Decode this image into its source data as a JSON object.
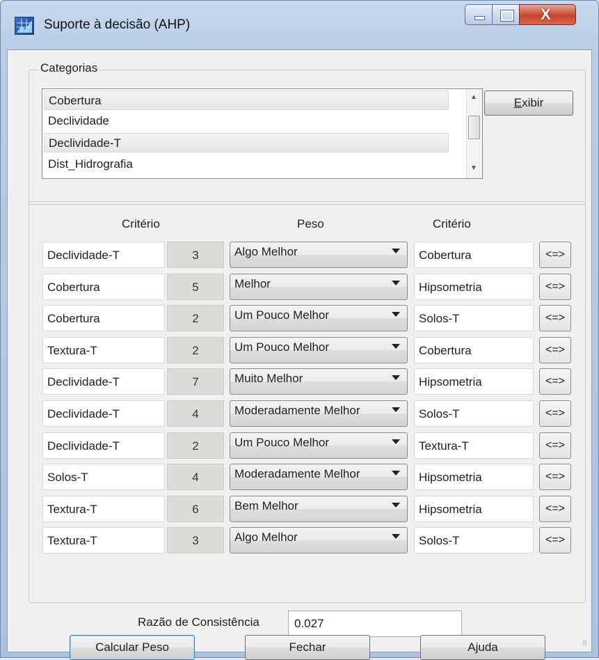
{
  "window": {
    "title": "Suporte à decisão (AHP)"
  },
  "categorias": {
    "label": "Categorias",
    "items": [
      "Cobertura",
      "Declividade",
      "Declividade-T",
      "Dist_Hidrografia"
    ],
    "exibir_label": "Exibir"
  },
  "table": {
    "header_criterio_left": "Critério",
    "header_peso": "Peso",
    "header_criterio_right": "Critério",
    "swap_label": "<=>",
    "rows": [
      {
        "left": "Declividade-T",
        "num": "3",
        "peso": "Algo Melhor",
        "right": "Cobertura"
      },
      {
        "left": "Cobertura",
        "num": "5",
        "peso": "Melhor",
        "right": "Hipsometria"
      },
      {
        "left": "Cobertura",
        "num": "2",
        "peso": "Um Pouco Melhor",
        "right": "Solos-T"
      },
      {
        "left": "Textura-T",
        "num": "2",
        "peso": "Um Pouco Melhor",
        "right": "Cobertura"
      },
      {
        "left": "Declividade-T",
        "num": "7",
        "peso": "Muito Melhor",
        "right": "Hipsometria"
      },
      {
        "left": "Declividade-T",
        "num": "4",
        "peso": "Moderadamente Melhor",
        "right": "Solos-T"
      },
      {
        "left": "Declividade-T",
        "num": "2",
        "peso": "Um Pouco Melhor",
        "right": "Textura-T"
      },
      {
        "left": "Solos-T",
        "num": "4",
        "peso": "Moderadamente Melhor",
        "right": "Hipsometria"
      },
      {
        "left": "Textura-T",
        "num": "6",
        "peso": "Bem Melhor",
        "right": "Hipsometria"
      },
      {
        "left": "Textura-T",
        "num": "3",
        "peso": "Algo Melhor",
        "right": "Solos-T"
      }
    ]
  },
  "razao": {
    "label": "Razão de Consistência",
    "value": "0.027"
  },
  "buttons": {
    "calcular": "Calcular Peso",
    "fechar": "Fechar",
    "ajuda": "Ajuda"
  }
}
